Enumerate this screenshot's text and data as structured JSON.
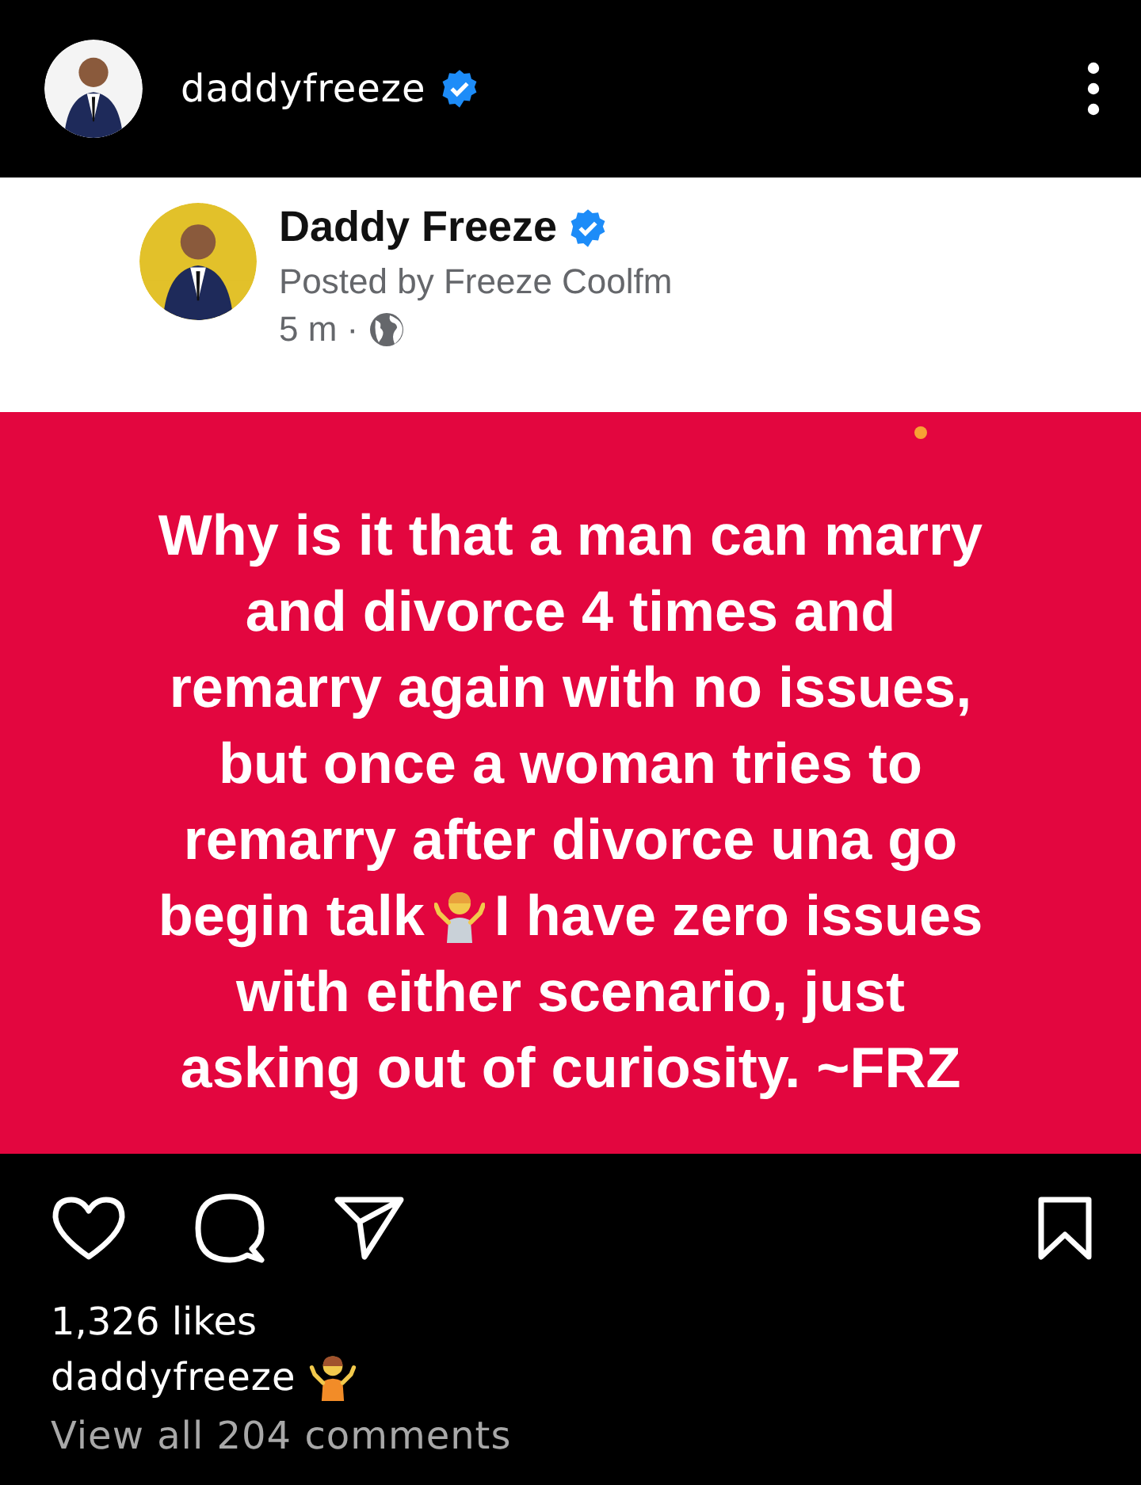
{
  "header": {
    "username": "daddyfreeze",
    "verified": true
  },
  "shared_post": {
    "author": "Daddy Freeze",
    "verified": true,
    "posted_by": "Posted by Freeze Coolfm",
    "time": "5 m",
    "separator": "·"
  },
  "post_text": {
    "lines": [
      {
        "kind": "text",
        "text": "Why is it that a man can marry"
      },
      {
        "kind": "text",
        "text": "and divorce 4 times and"
      },
      {
        "kind": "text",
        "text": "remarry again with no issues,"
      },
      {
        "kind": "text",
        "text": "but once a woman tries to"
      },
      {
        "kind": "text",
        "text": "remarry after divorce una go"
      },
      {
        "kind": "emoji",
        "before": "begin talk",
        "after": "I have zero issues"
      },
      {
        "kind": "text",
        "text": "with either scenario, just"
      },
      {
        "kind": "text",
        "text": "asking out of curiosity. ~FRZ"
      }
    ]
  },
  "likes": "1,326 likes",
  "caption": {
    "username": "daddyfreeze"
  },
  "comments_link": "View all 204 comments"
}
